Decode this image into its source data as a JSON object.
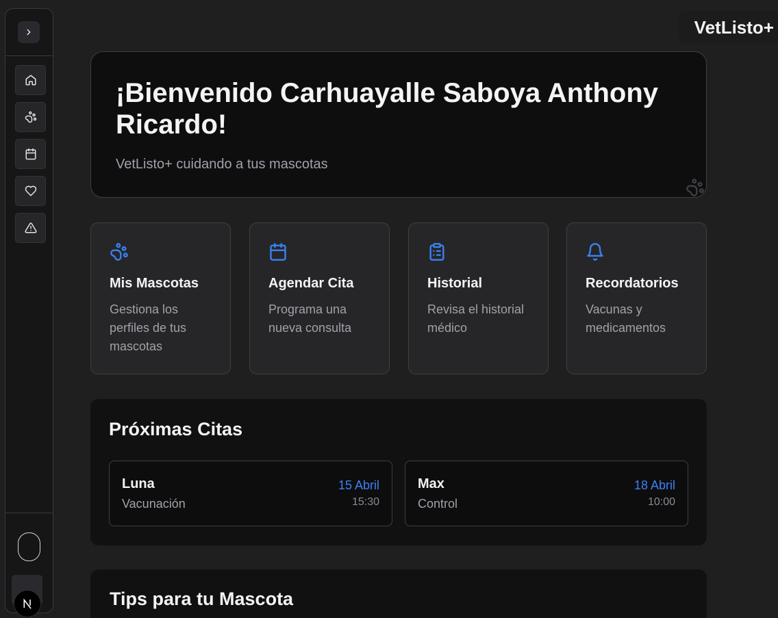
{
  "brand": {
    "name": "VetListo+"
  },
  "sidebar": {
    "toggle_icon": "chevron-right-icon",
    "items": [
      {
        "icon": "home-icon",
        "name": "home"
      },
      {
        "icon": "paw-icon",
        "name": "pets"
      },
      {
        "icon": "calendar-icon",
        "name": "appointments"
      },
      {
        "icon": "heart-icon",
        "name": "health"
      },
      {
        "icon": "alert-triangle-icon",
        "name": "alerts"
      }
    ]
  },
  "hero": {
    "title": "¡Bienvenido Carhuayalle Saboya Anthony Ricardo!",
    "subtitle": "VetListo+ cuidando a tus mascotas"
  },
  "cards": [
    {
      "icon": "paw-icon",
      "title": "Mis Mascotas",
      "description": "Gestiona los perfiles de tus mascotas"
    },
    {
      "icon": "calendar-icon",
      "title": "Agendar Cita",
      "description": "Programa una nueva consulta"
    },
    {
      "icon": "clipboard-list-icon",
      "title": "Historial",
      "description": "Revisa el historial médico"
    },
    {
      "icon": "bell-icon",
      "title": "Recordatorios",
      "description": "Vacunas y medicamentos"
    }
  ],
  "appointments": {
    "title": "Próximas Citas",
    "items": [
      {
        "pet": "Luna",
        "type": "Vacunación",
        "date": "15 Abril",
        "time": "15:30"
      },
      {
        "pet": "Max",
        "type": "Control",
        "date": "18 Abril",
        "time": "10:00"
      }
    ]
  },
  "tips": {
    "title": "Tips para tu Mascota"
  },
  "colors": {
    "accent": "#3b82f6",
    "background": "#1f1f1f",
    "card": "#262629"
  }
}
